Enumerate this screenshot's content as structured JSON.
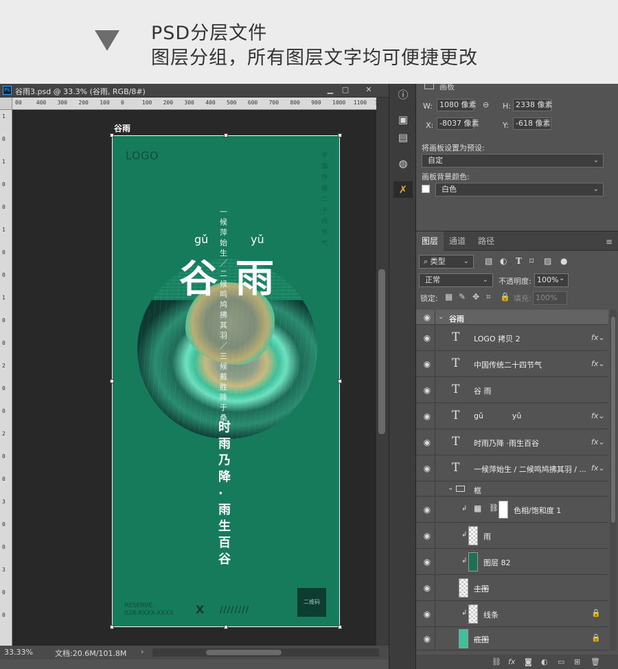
{
  "header": {
    "line1": "PSD分层文件",
    "line2": "图层分组，所有图层文字均可便捷更改"
  },
  "document": {
    "ps_badge": "Ps",
    "title": "谷雨3.psd @ 33.3% (谷雨, RGB/8#)",
    "ruler_h_labels": [
      "00",
      "400",
      "300",
      "200",
      "100",
      "0",
      "100",
      "200",
      "300",
      "400",
      "500",
      "600",
      "700",
      "800",
      "900",
      "1000",
      "1100",
      "120"
    ],
    "ruler_v_labels": [
      "1",
      "0",
      "1",
      "0",
      "0",
      "1",
      "0",
      "0",
      "1",
      "0",
      "0",
      "2",
      "0",
      "0",
      "2",
      "0",
      "0",
      "3",
      "0",
      "0",
      "3",
      "0",
      "0"
    ],
    "artboard_label": "谷雨",
    "zoom": "33.33%",
    "doc_size": "文档:20.6M/101.8M"
  },
  "poster": {
    "logo": "LOGO",
    "vertical_right": "中国传统二十四节气",
    "pinyin_gu": "gǔ",
    "pinyin_yu": "yǔ",
    "title": "谷雨",
    "vertical_poem": "一候萍始生／二候鸣鸠拂其羽／三候戴胜降于桑",
    "slogan": "时雨乃降·雨生百谷",
    "reserve_line1": "RESERVE:",
    "reserve_line2": "028-XXXX-XXXX",
    "x_mark": "X",
    "slashes": "////////",
    "qr_label": "二维码"
  },
  "properties": {
    "artboard_header": "画板",
    "w_label": "W:",
    "w_value": "1080 像素",
    "h_label": "H:",
    "h_value": "2338 像素",
    "x_label": "X:",
    "x_value": "-8037 像素",
    "y_label": "Y:",
    "y_value": "-618 像素",
    "preset_label": "将画板设置为预设:",
    "preset_value": "自定",
    "bg_label": "画板背景颜色:",
    "bg_value": "白色"
  },
  "layers_panel": {
    "tabs": [
      "图层",
      "通道",
      "路径"
    ],
    "filter": "类型",
    "blend_mode": "正常",
    "opacity_label": "不透明度:",
    "opacity_value": "100%",
    "lock_label": "锁定:",
    "fill_label": "填充:",
    "fill_value": "100%",
    "layers": [
      {
        "name": "谷雨",
        "kind": "group"
      },
      {
        "name": "LOGO 拷贝 2",
        "kind": "text",
        "fx": true
      },
      {
        "name": "中国传统二十四节气",
        "kind": "text",
        "fx": true
      },
      {
        "name": "谷 雨",
        "kind": "text",
        "fx": false
      },
      {
        "name": "gǔ            yǔ",
        "kind": "text",
        "fx": true
      },
      {
        "name": "时雨乃降 ·雨生百谷",
        "kind": "text",
        "fx": true
      },
      {
        "name": "一候萍始生 / 二候鸣鸠拂其羽 / ...",
        "kind": "text",
        "fx": true
      },
      {
        "name": "框",
        "kind": "subgroup"
      },
      {
        "name": "色相/饱和度 1",
        "kind": "adjustment"
      },
      {
        "name": "雨",
        "kind": "pixel"
      },
      {
        "name": "图层 82",
        "kind": "pixel"
      },
      {
        "name": "主图",
        "kind": "pixel"
      },
      {
        "name": "线条",
        "kind": "pixel",
        "locked": true
      },
      {
        "name": "底图",
        "kind": "pixel",
        "locked": true
      }
    ]
  },
  "icons": {
    "eye": "◉",
    "fx": "fx",
    "lock": "🔒",
    "text_type": "T"
  }
}
